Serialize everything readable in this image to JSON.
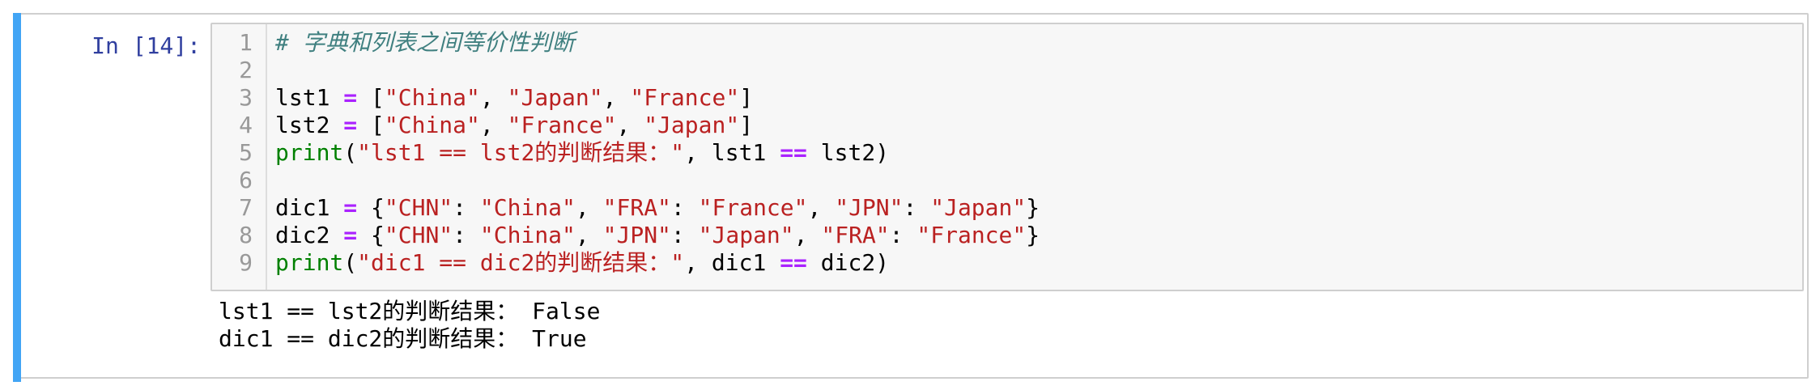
{
  "cell": {
    "prompt": "In [14]:",
    "line_numbers": [
      "1",
      "2",
      "3",
      "4",
      "5",
      "6",
      "7",
      "8",
      "9"
    ],
    "code": {
      "comment": "# 字典和列表之间等价性判断",
      "lst1_var": "lst1 ",
      "eq_op": "=",
      "bracket_open": " [",
      "s_china": "\"China\"",
      "s_japan": "\"Japan\"",
      "s_france": "\"France\"",
      "comma": ", ",
      "bracket_close": "]",
      "lst2_var": "lst2 ",
      "print_fn": "print",
      "paren_open": "(",
      "s_lst_msg": "\"lst1 == lst2的判断结果：\"",
      "lst_args_mid": ", lst1 ",
      "eqeq_op": "==",
      "lst_args_end": " lst2)",
      "dic1_var": "dic1 ",
      "brace_open": " {",
      "s_chn": "\"CHN\"",
      "s_fra": "\"FRA\"",
      "s_jpn": "\"JPN\"",
      "colon": ": ",
      "brace_close": "}",
      "dic2_var": "dic2 ",
      "s_dic_msg": "\"dic1 == dic2的判断结果：\"",
      "dic_args_mid": ", dic1 ",
      "dic_args_end": " dic2)"
    },
    "output": [
      "lst1 == lst2的判断结果： False",
      "dic1 == dic2的判断结果： True"
    ]
  },
  "colors": {
    "prompt": "#303f9f",
    "selection_bar": "#42a5f5",
    "string": "#ba2121",
    "operator": "#aa22ff",
    "builtin": "#008000",
    "comment": "#408080"
  }
}
